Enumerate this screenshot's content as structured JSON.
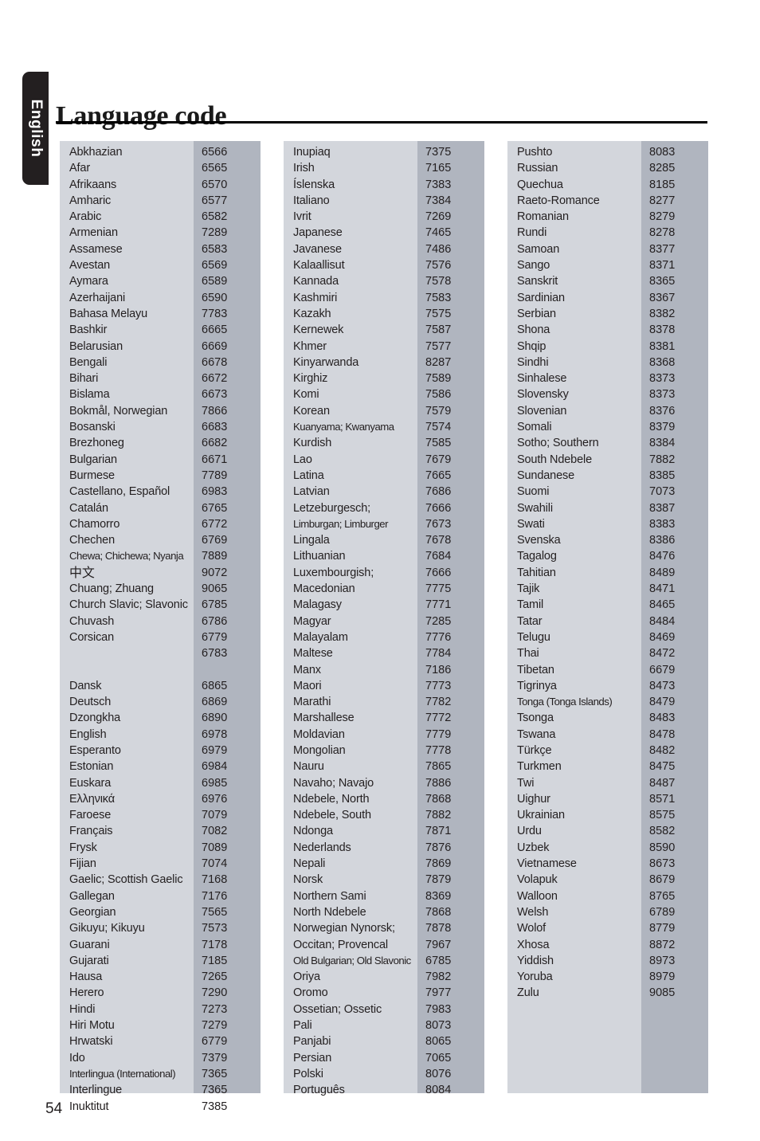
{
  "page": {
    "title": "Language code",
    "side_tab_label": "English",
    "page_number": "54",
    "colors": {
      "name_cell_bg": "#d3d6dc",
      "code_cell_bg": "#b0b5bf",
      "tab_bg": "#231f20",
      "text": "#231f20",
      "rule": "#000000"
    }
  },
  "table": {
    "columns": [
      {
        "id": "column-1",
        "rows": [
          {
            "name": "Abkhazian",
            "code": "6566"
          },
          {
            "name": "Afar",
            "code": "6565"
          },
          {
            "name": "Afrikaans",
            "code": "6570"
          },
          {
            "name": "Amharic",
            "code": "6577"
          },
          {
            "name": "Arabic",
            "code": "6582"
          },
          {
            "name": "Armenian",
            "code": "7289"
          },
          {
            "name": "Assamese",
            "code": "6583"
          },
          {
            "name": "Avestan",
            "code": "6569"
          },
          {
            "name": "Aymara",
            "code": "6589"
          },
          {
            "name": "Azerhaijani",
            "code": "6590"
          },
          {
            "name": "Bahasa Melayu",
            "code": "7783"
          },
          {
            "name": "Bashkir",
            "code": "6665"
          },
          {
            "name": "Belarusian",
            "code": "6669"
          },
          {
            "name": "Bengali",
            "code": "6678"
          },
          {
            "name": "Bihari",
            "code": "6672"
          },
          {
            "name": "Bislama",
            "code": "6673"
          },
          {
            "name": "Bokmål, Norwegian",
            "code": "7866"
          },
          {
            "name": "Bosanski",
            "code": "6683"
          },
          {
            "name": "Brezhoneg",
            "code": "6682"
          },
          {
            "name": "Bulgarian",
            "code": "6671"
          },
          {
            "name": "Burmese",
            "code": "7789"
          },
          {
            "name": "Castellano, Español",
            "code": "6983"
          },
          {
            "name": "Catalán",
            "code": "6765"
          },
          {
            "name": "Chamorro",
            "code": "6772"
          },
          {
            "name": "Chechen",
            "code": "6769"
          },
          {
            "name": "Chewa; Chichewa; Nyanja",
            "code": "7889",
            "style": "tight"
          },
          {
            "name": "中文",
            "code": "9072",
            "style": "cjk"
          },
          {
            "name": "Chuang; Zhuang",
            "code": "9065"
          },
          {
            "name": "Church Slavic; Slavonic",
            "code": "6785"
          },
          {
            "name": "Chuvash",
            "code": "6786"
          },
          {
            "name": "Corsican",
            "code": "6779"
          },
          {
            "name": "",
            "code": "6783"
          },
          {
            "name": "",
            "code": ""
          },
          {
            "name": "Dansk",
            "code": "6865"
          },
          {
            "name": "Deutsch",
            "code": "6869"
          },
          {
            "name": "Dzongkha",
            "code": "6890"
          },
          {
            "name": "English",
            "code": "6978"
          },
          {
            "name": "Esperanto",
            "code": "6979"
          },
          {
            "name": "Estonian",
            "code": "6984"
          },
          {
            "name": "Euskara",
            "code": "6985"
          },
          {
            "name": "Ελληνικά",
            "code": "6976"
          },
          {
            "name": "Faroese",
            "code": "7079"
          },
          {
            "name": "Français",
            "code": "7082"
          },
          {
            "name": "Frysk",
            "code": "7089"
          },
          {
            "name": "Fijian",
            "code": "7074"
          },
          {
            "name": "Gaelic; Scottish Gaelic",
            "code": "7168"
          },
          {
            "name": "Gallegan",
            "code": "7176"
          },
          {
            "name": "Georgian",
            "code": "7565"
          },
          {
            "name": "Gikuyu; Kikuyu",
            "code": "7573"
          },
          {
            "name": "Guarani",
            "code": "7178"
          },
          {
            "name": "Gujarati",
            "code": "7185"
          },
          {
            "name": "Hausa",
            "code": "7265"
          },
          {
            "name": "Herero",
            "code": "7290"
          },
          {
            "name": "Hindi",
            "code": "7273"
          },
          {
            "name": "Hiri Motu",
            "code": "7279"
          },
          {
            "name": "Hrwatski",
            "code": "6779"
          },
          {
            "name": "Ido",
            "code": "7379"
          },
          {
            "name": "Interlingua (International)",
            "code": "7365",
            "style": "tight"
          },
          {
            "name": "Interlingue",
            "code": "7365"
          },
          {
            "name": "Inuktitut",
            "code": "7385"
          }
        ]
      },
      {
        "id": "column-2",
        "rows": [
          {
            "name": "Inupiaq",
            "code": "7375"
          },
          {
            "name": "Irish",
            "code": "7165"
          },
          {
            "name": "Íslenska",
            "code": "7383"
          },
          {
            "name": "Italiano",
            "code": "7384"
          },
          {
            "name": "Ivrit",
            "code": "7269"
          },
          {
            "name": "Japanese",
            "code": "7465"
          },
          {
            "name": "Javanese",
            "code": "7486"
          },
          {
            "name": "Kalaallisut",
            "code": "7576"
          },
          {
            "name": "Kannada",
            "code": "7578"
          },
          {
            "name": "Kashmiri",
            "code": "7583"
          },
          {
            "name": "Kazakh",
            "code": "7575"
          },
          {
            "name": "Kernewek",
            "code": "7587"
          },
          {
            "name": "Khmer",
            "code": "7577"
          },
          {
            "name": "Kinyarwanda",
            "code": "8287"
          },
          {
            "name": "Kirghiz",
            "code": "7589"
          },
          {
            "name": "Komi",
            "code": "7586"
          },
          {
            "name": "Korean",
            "code": "7579"
          },
          {
            "name": "Kuanyama; Kwanyama",
            "code": "7574",
            "style": "tight"
          },
          {
            "name": "Kurdish",
            "code": "7585"
          },
          {
            "name": "Lao",
            "code": "7679"
          },
          {
            "name": "Latina",
            "code": "7665"
          },
          {
            "name": "Latvian",
            "code": "7686"
          },
          {
            "name": "Letzeburgesch;",
            "code": "7666"
          },
          {
            "name": "Limburgan; Limburger",
            "code": "7673",
            "style": "tight"
          },
          {
            "name": "Lingala",
            "code": "7678"
          },
          {
            "name": "Lithuanian",
            "code": "7684"
          },
          {
            "name": "Luxembourgish;",
            "code": "7666"
          },
          {
            "name": "Macedonian",
            "code": "7775"
          },
          {
            "name": "Malagasy",
            "code": "7771"
          },
          {
            "name": "Magyar",
            "code": "7285"
          },
          {
            "name": "Malayalam",
            "code": "7776"
          },
          {
            "name": "Maltese",
            "code": "7784"
          },
          {
            "name": "Manx",
            "code": "7186"
          },
          {
            "name": "Maori",
            "code": "7773"
          },
          {
            "name": "Marathi",
            "code": "7782"
          },
          {
            "name": "Marshallese",
            "code": "7772"
          },
          {
            "name": "Moldavian",
            "code": "7779"
          },
          {
            "name": "Mongolian",
            "code": "7778"
          },
          {
            "name": "Nauru",
            "code": "7865"
          },
          {
            "name": "Navaho; Navajo",
            "code": "7886"
          },
          {
            "name": "Ndebele, North",
            "code": "7868"
          },
          {
            "name": "Ndebele, South",
            "code": "7882"
          },
          {
            "name": "Ndonga",
            "code": "7871"
          },
          {
            "name": "Nederlands",
            "code": "7876"
          },
          {
            "name": "Nepali",
            "code": "7869"
          },
          {
            "name": "Norsk",
            "code": "7879"
          },
          {
            "name": "Northern Sami",
            "code": "8369"
          },
          {
            "name": "North Ndebele",
            "code": "7868"
          },
          {
            "name": "Norwegian Nynorsk;",
            "code": "7878"
          },
          {
            "name": "Occitan; Provencal",
            "code": "7967"
          },
          {
            "name": "Old Bulgarian; Old Slavonic",
            "code": "6785",
            "style": "tight"
          },
          {
            "name": "Oriya",
            "code": "7982"
          },
          {
            "name": "Oromo",
            "code": "7977"
          },
          {
            "name": "Ossetian; Ossetic",
            "code": "7983"
          },
          {
            "name": "Pali",
            "code": "8073"
          },
          {
            "name": "Panjabi",
            "code": "8065"
          },
          {
            "name": "Persian",
            "code": "7065"
          },
          {
            "name": "Polski",
            "code": "8076"
          },
          {
            "name": "Português",
            "code": "8084"
          }
        ]
      },
      {
        "id": "column-3",
        "rows": [
          {
            "name": "Pushto",
            "code": "8083"
          },
          {
            "name": "Russian",
            "code": "8285"
          },
          {
            "name": "Quechua",
            "code": "8185"
          },
          {
            "name": "Raeto-Romance",
            "code": "8277"
          },
          {
            "name": "Romanian",
            "code": "8279"
          },
          {
            "name": "Rundi",
            "code": "8278"
          },
          {
            "name": "Samoan",
            "code": "8377"
          },
          {
            "name": "Sango",
            "code": "8371"
          },
          {
            "name": "Sanskrit",
            "code": "8365"
          },
          {
            "name": "Sardinian",
            "code": "8367"
          },
          {
            "name": "Serbian",
            "code": "8382"
          },
          {
            "name": "Shona",
            "code": "8378"
          },
          {
            "name": "Shqip",
            "code": "8381"
          },
          {
            "name": "Sindhi",
            "code": "8368"
          },
          {
            "name": "Sinhalese",
            "code": "8373"
          },
          {
            "name": "Slovensky",
            "code": "8373"
          },
          {
            "name": "Slovenian",
            "code": "8376"
          },
          {
            "name": "Somali",
            "code": "8379"
          },
          {
            "name": "Sotho; Southern",
            "code": "8384"
          },
          {
            "name": "South Ndebele",
            "code": "7882"
          },
          {
            "name": "Sundanese",
            "code": "8385"
          },
          {
            "name": "Suomi",
            "code": "7073"
          },
          {
            "name": "Swahili",
            "code": "8387"
          },
          {
            "name": "Swati",
            "code": "8383"
          },
          {
            "name": "Svenska",
            "code": "8386"
          },
          {
            "name": "Tagalog",
            "code": "8476"
          },
          {
            "name": "Tahitian",
            "code": "8489"
          },
          {
            "name": "Tajik",
            "code": "8471"
          },
          {
            "name": "Tamil",
            "code": "8465"
          },
          {
            "name": "Tatar",
            "code": "8484"
          },
          {
            "name": "Telugu",
            "code": "8469"
          },
          {
            "name": "Thai",
            "code": "8472"
          },
          {
            "name": "Tibetan",
            "code": "6679"
          },
          {
            "name": "Tigrinya",
            "code": "8473"
          },
          {
            "name": "Tonga (Tonga Islands)",
            "code": "8479",
            "style": "tight"
          },
          {
            "name": "Tsonga",
            "code": "8483"
          },
          {
            "name": "Tswana",
            "code": "8478"
          },
          {
            "name": "Türkçe",
            "code": "8482"
          },
          {
            "name": "Turkmen",
            "code": "8475"
          },
          {
            "name": "Twi",
            "code": "8487"
          },
          {
            "name": "Uighur",
            "code": "8571"
          },
          {
            "name": "Ukrainian",
            "code": "8575"
          },
          {
            "name": "Urdu",
            "code": "8582"
          },
          {
            "name": "Uzbek",
            "code": "8590"
          },
          {
            "name": "Vietnamese",
            "code": "8673"
          },
          {
            "name": "Volapuk",
            "code": "8679"
          },
          {
            "name": "Walloon",
            "code": "8765"
          },
          {
            "name": "Welsh",
            "code": "6789"
          },
          {
            "name": "Wolof",
            "code": "8779"
          },
          {
            "name": "Xhosa",
            "code": "8872"
          },
          {
            "name": "Yiddish",
            "code": "8973"
          },
          {
            "name": "Yoruba",
            "code": "8979"
          },
          {
            "name": "Zulu",
            "code": "9085"
          }
        ]
      }
    ]
  }
}
